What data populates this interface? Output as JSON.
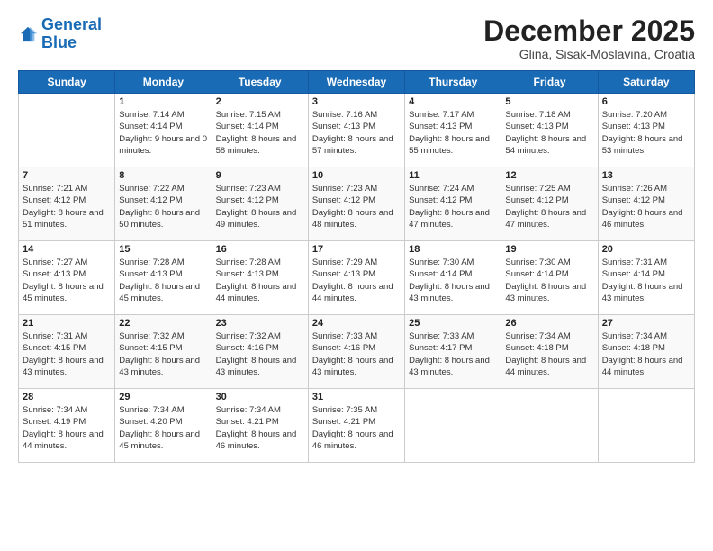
{
  "logo": {
    "line1": "General",
    "line2": "Blue"
  },
  "header": {
    "month": "December 2025",
    "location": "Glina, Sisak-Moslavina, Croatia"
  },
  "days_of_week": [
    "Sunday",
    "Monday",
    "Tuesday",
    "Wednesday",
    "Thursday",
    "Friday",
    "Saturday"
  ],
  "weeks": [
    [
      {
        "day": "",
        "sunrise": "",
        "sunset": "",
        "daylight": ""
      },
      {
        "day": "1",
        "sunrise": "Sunrise: 7:14 AM",
        "sunset": "Sunset: 4:14 PM",
        "daylight": "Daylight: 9 hours and 0 minutes."
      },
      {
        "day": "2",
        "sunrise": "Sunrise: 7:15 AM",
        "sunset": "Sunset: 4:14 PM",
        "daylight": "Daylight: 8 hours and 58 minutes."
      },
      {
        "day": "3",
        "sunrise": "Sunrise: 7:16 AM",
        "sunset": "Sunset: 4:13 PM",
        "daylight": "Daylight: 8 hours and 57 minutes."
      },
      {
        "day": "4",
        "sunrise": "Sunrise: 7:17 AM",
        "sunset": "Sunset: 4:13 PM",
        "daylight": "Daylight: 8 hours and 55 minutes."
      },
      {
        "day": "5",
        "sunrise": "Sunrise: 7:18 AM",
        "sunset": "Sunset: 4:13 PM",
        "daylight": "Daylight: 8 hours and 54 minutes."
      },
      {
        "day": "6",
        "sunrise": "Sunrise: 7:20 AM",
        "sunset": "Sunset: 4:13 PM",
        "daylight": "Daylight: 8 hours and 53 minutes."
      }
    ],
    [
      {
        "day": "7",
        "sunrise": "Sunrise: 7:21 AM",
        "sunset": "Sunset: 4:12 PM",
        "daylight": "Daylight: 8 hours and 51 minutes."
      },
      {
        "day": "8",
        "sunrise": "Sunrise: 7:22 AM",
        "sunset": "Sunset: 4:12 PM",
        "daylight": "Daylight: 8 hours and 50 minutes."
      },
      {
        "day": "9",
        "sunrise": "Sunrise: 7:23 AM",
        "sunset": "Sunset: 4:12 PM",
        "daylight": "Daylight: 8 hours and 49 minutes."
      },
      {
        "day": "10",
        "sunrise": "Sunrise: 7:23 AM",
        "sunset": "Sunset: 4:12 PM",
        "daylight": "Daylight: 8 hours and 48 minutes."
      },
      {
        "day": "11",
        "sunrise": "Sunrise: 7:24 AM",
        "sunset": "Sunset: 4:12 PM",
        "daylight": "Daylight: 8 hours and 47 minutes."
      },
      {
        "day": "12",
        "sunrise": "Sunrise: 7:25 AM",
        "sunset": "Sunset: 4:12 PM",
        "daylight": "Daylight: 8 hours and 47 minutes."
      },
      {
        "day": "13",
        "sunrise": "Sunrise: 7:26 AM",
        "sunset": "Sunset: 4:12 PM",
        "daylight": "Daylight: 8 hours and 46 minutes."
      }
    ],
    [
      {
        "day": "14",
        "sunrise": "Sunrise: 7:27 AM",
        "sunset": "Sunset: 4:13 PM",
        "daylight": "Daylight: 8 hours and 45 minutes."
      },
      {
        "day": "15",
        "sunrise": "Sunrise: 7:28 AM",
        "sunset": "Sunset: 4:13 PM",
        "daylight": "Daylight: 8 hours and 45 minutes."
      },
      {
        "day": "16",
        "sunrise": "Sunrise: 7:28 AM",
        "sunset": "Sunset: 4:13 PM",
        "daylight": "Daylight: 8 hours and 44 minutes."
      },
      {
        "day": "17",
        "sunrise": "Sunrise: 7:29 AM",
        "sunset": "Sunset: 4:13 PM",
        "daylight": "Daylight: 8 hours and 44 minutes."
      },
      {
        "day": "18",
        "sunrise": "Sunrise: 7:30 AM",
        "sunset": "Sunset: 4:14 PM",
        "daylight": "Daylight: 8 hours and 43 minutes."
      },
      {
        "day": "19",
        "sunrise": "Sunrise: 7:30 AM",
        "sunset": "Sunset: 4:14 PM",
        "daylight": "Daylight: 8 hours and 43 minutes."
      },
      {
        "day": "20",
        "sunrise": "Sunrise: 7:31 AM",
        "sunset": "Sunset: 4:14 PM",
        "daylight": "Daylight: 8 hours and 43 minutes."
      }
    ],
    [
      {
        "day": "21",
        "sunrise": "Sunrise: 7:31 AM",
        "sunset": "Sunset: 4:15 PM",
        "daylight": "Daylight: 8 hours and 43 minutes."
      },
      {
        "day": "22",
        "sunrise": "Sunrise: 7:32 AM",
        "sunset": "Sunset: 4:15 PM",
        "daylight": "Daylight: 8 hours and 43 minutes."
      },
      {
        "day": "23",
        "sunrise": "Sunrise: 7:32 AM",
        "sunset": "Sunset: 4:16 PM",
        "daylight": "Daylight: 8 hours and 43 minutes."
      },
      {
        "day": "24",
        "sunrise": "Sunrise: 7:33 AM",
        "sunset": "Sunset: 4:16 PM",
        "daylight": "Daylight: 8 hours and 43 minutes."
      },
      {
        "day": "25",
        "sunrise": "Sunrise: 7:33 AM",
        "sunset": "Sunset: 4:17 PM",
        "daylight": "Daylight: 8 hours and 43 minutes."
      },
      {
        "day": "26",
        "sunrise": "Sunrise: 7:34 AM",
        "sunset": "Sunset: 4:18 PM",
        "daylight": "Daylight: 8 hours and 44 minutes."
      },
      {
        "day": "27",
        "sunrise": "Sunrise: 7:34 AM",
        "sunset": "Sunset: 4:18 PM",
        "daylight": "Daylight: 8 hours and 44 minutes."
      }
    ],
    [
      {
        "day": "28",
        "sunrise": "Sunrise: 7:34 AM",
        "sunset": "Sunset: 4:19 PM",
        "daylight": "Daylight: 8 hours and 44 minutes."
      },
      {
        "day": "29",
        "sunrise": "Sunrise: 7:34 AM",
        "sunset": "Sunset: 4:20 PM",
        "daylight": "Daylight: 8 hours and 45 minutes."
      },
      {
        "day": "30",
        "sunrise": "Sunrise: 7:34 AM",
        "sunset": "Sunset: 4:21 PM",
        "daylight": "Daylight: 8 hours and 46 minutes."
      },
      {
        "day": "31",
        "sunrise": "Sunrise: 7:35 AM",
        "sunset": "Sunset: 4:21 PM",
        "daylight": "Daylight: 8 hours and 46 minutes."
      },
      {
        "day": "",
        "sunrise": "",
        "sunset": "",
        "daylight": ""
      },
      {
        "day": "",
        "sunrise": "",
        "sunset": "",
        "daylight": ""
      },
      {
        "day": "",
        "sunrise": "",
        "sunset": "",
        "daylight": ""
      }
    ]
  ]
}
